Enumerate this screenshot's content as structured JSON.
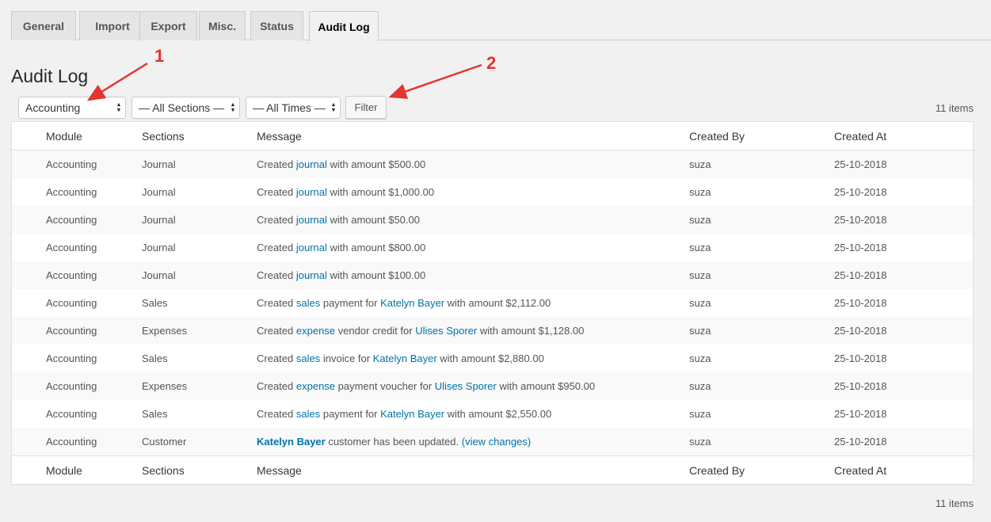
{
  "tabs": [
    {
      "label": "General"
    },
    {
      "label": "Import"
    },
    {
      "label": "Export"
    },
    {
      "label": "Misc."
    },
    {
      "label": "Status"
    },
    {
      "label": "Audit Log",
      "active": true
    }
  ],
  "page_title": "Audit Log",
  "filters": {
    "module": "Accounting",
    "sections": "— All Sections —",
    "times": "— All Times —",
    "filter_button": "Filter"
  },
  "items_count": "11 items",
  "columns": {
    "module": "Module",
    "sections": "Sections",
    "message": "Message",
    "created_by": "Created By",
    "created_at": "Created At"
  },
  "rows": [
    {
      "module": "Accounting",
      "section": "Journal",
      "message": [
        {
          "t": "Created "
        },
        {
          "t": "journal",
          "link": true
        },
        {
          "t": " with amount $500.00"
        }
      ],
      "by": "suza",
      "at": "25-10-2018"
    },
    {
      "module": "Accounting",
      "section": "Journal",
      "message": [
        {
          "t": "Created "
        },
        {
          "t": "journal",
          "link": true
        },
        {
          "t": " with amount $1,000.00"
        }
      ],
      "by": "suza",
      "at": "25-10-2018"
    },
    {
      "module": "Accounting",
      "section": "Journal",
      "message": [
        {
          "t": "Created "
        },
        {
          "t": "journal",
          "link": true
        },
        {
          "t": " with amount $50.00"
        }
      ],
      "by": "suza",
      "at": "25-10-2018"
    },
    {
      "module": "Accounting",
      "section": "Journal",
      "message": [
        {
          "t": "Created "
        },
        {
          "t": "journal",
          "link": true
        },
        {
          "t": " with amount $800.00"
        }
      ],
      "by": "suza",
      "at": "25-10-2018"
    },
    {
      "module": "Accounting",
      "section": "Journal",
      "message": [
        {
          "t": "Created "
        },
        {
          "t": "journal",
          "link": true
        },
        {
          "t": " with amount $100.00"
        }
      ],
      "by": "suza",
      "at": "25-10-2018"
    },
    {
      "module": "Accounting",
      "section": "Sales",
      "message": [
        {
          "t": "Created "
        },
        {
          "t": "sales",
          "link": true
        },
        {
          "t": " payment for "
        },
        {
          "t": "Katelyn Bayer",
          "link": true
        },
        {
          "t": " with amount $2,112.00"
        }
      ],
      "by": "suza",
      "at": "25-10-2018"
    },
    {
      "module": "Accounting",
      "section": "Expenses",
      "message": [
        {
          "t": "Created "
        },
        {
          "t": "expense",
          "link": true
        },
        {
          "t": " vendor credit for "
        },
        {
          "t": "Ulises Sporer",
          "link": true
        },
        {
          "t": " with amount $1,128.00"
        }
      ],
      "by": "suza",
      "at": "25-10-2018"
    },
    {
      "module": "Accounting",
      "section": "Sales",
      "message": [
        {
          "t": "Created "
        },
        {
          "t": "sales",
          "link": true
        },
        {
          "t": " invoice for "
        },
        {
          "t": "Katelyn Bayer",
          "link": true
        },
        {
          "t": " with amount $2,880.00"
        }
      ],
      "by": "suza",
      "at": "25-10-2018"
    },
    {
      "module": "Accounting",
      "section": "Expenses",
      "message": [
        {
          "t": "Created "
        },
        {
          "t": "expense",
          "link": true
        },
        {
          "t": " payment voucher for "
        },
        {
          "t": "Ulises Sporer",
          "link": true
        },
        {
          "t": " with amount $950.00"
        }
      ],
      "by": "suza",
      "at": "25-10-2018"
    },
    {
      "module": "Accounting",
      "section": "Sales",
      "message": [
        {
          "t": "Created "
        },
        {
          "t": "sales",
          "link": true
        },
        {
          "t": " payment for "
        },
        {
          "t": "Katelyn Bayer",
          "link": true
        },
        {
          "t": " with amount $2,550.00"
        }
      ],
      "by": "suza",
      "at": "25-10-2018"
    },
    {
      "module": "Accounting",
      "section": "Customer",
      "message": [
        {
          "t": "Katelyn Bayer",
          "link": true,
          "bold": true
        },
        {
          "t": " customer has been updated. "
        },
        {
          "t": "(view changes)",
          "link": true
        }
      ],
      "by": "suza",
      "at": "25-10-2018"
    }
  ],
  "annotations": {
    "label_1": "1",
    "label_2": "2",
    "color": "#e3342f"
  },
  "colors": {
    "link": "#0073aa",
    "background": "#f1f1f1"
  }
}
